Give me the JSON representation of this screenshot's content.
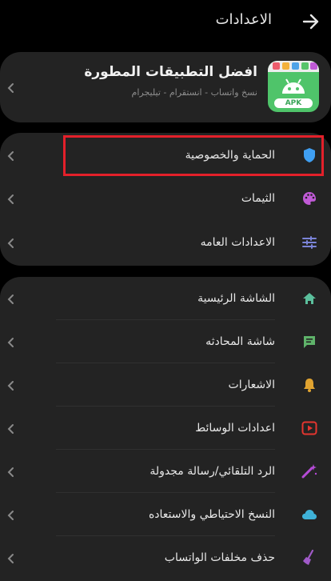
{
  "header": {
    "title": "الاعدادات"
  },
  "profile": {
    "app_name": "افضل التطبيقات المطورة",
    "subtitle": "نسخ واتساب - انستقرام - تيليجرام",
    "icon_label": "APK"
  },
  "settings_group": [
    {
      "label": "الحماية والخصوصية",
      "icon": "shield-icon",
      "color": "#3f9ff2"
    },
    {
      "label": "الثيمات",
      "icon": "palette-icon",
      "color": "#c05ad6"
    },
    {
      "label": "الاعدادات العامه",
      "icon": "tune-icon",
      "color": "#7b84d8"
    }
  ],
  "features_group": [
    {
      "label": "الشاشة الرئيسية",
      "icon": "home-icon",
      "color": "#5bbf9c"
    },
    {
      "label": "شاشة المحادثه",
      "icon": "chat-icon",
      "color": "#5fb36a"
    },
    {
      "label": "الاشعارات",
      "icon": "bell-icon",
      "color": "#e0a330"
    },
    {
      "label": "اعدادات الوسائط",
      "icon": "play-icon",
      "color": "#e4352f"
    },
    {
      "label": "الرد التلقائي/رسالة مجدولة",
      "icon": "magic-wand-icon",
      "color": "#b54bd6"
    },
    {
      "label": "النسخ الاحتياطي والاستعاده",
      "icon": "cloud-icon",
      "color": "#3fb2d8"
    },
    {
      "label": "حذف مخلفات الواتساب",
      "icon": "broom-icon",
      "color": "#a05ac8"
    }
  ]
}
